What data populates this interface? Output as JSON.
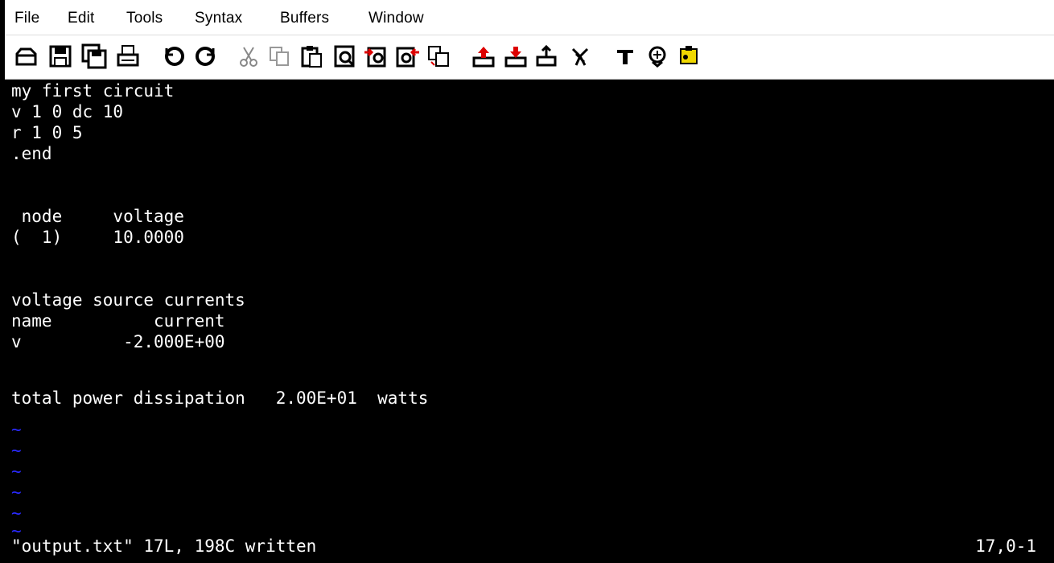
{
  "menu": {
    "items": [
      {
        "label": "File"
      },
      {
        "label": "Edit"
      },
      {
        "label": "Tools"
      },
      {
        "label": "Syntax"
      },
      {
        "label": "Buffers"
      },
      {
        "label": "Window"
      }
    ]
  },
  "toolbar": {
    "icons": [
      "open-icon",
      "save-icon",
      "save-all-icon",
      "print-icon",
      "undo-icon",
      "redo-icon",
      "cut-icon",
      "copy-icon",
      "paste-icon",
      "find-icon",
      "find-next-icon",
      "find-prev-icon",
      "replace-icon",
      "load-session-icon",
      "save-session-icon",
      "run-script-icon",
      "make-icon",
      "shell-icon",
      "ctags-icon"
    ]
  },
  "editor": {
    "lines": [
      "my first circuit",
      "v 1 0 dc 10",
      "r 1 0 5",
      ".end",
      "",
      "",
      " node     voltage",
      "(  1)     10.0000",
      "",
      "",
      "voltage source currents",
      "name          current",
      "v          -2.000E+00",
      "",
      "",
      "total power dissipation   2.00E+01  watts"
    ],
    "tilde_char": "~",
    "tilde_color": "#2a2aff"
  },
  "status": {
    "message": "\"output.txt\" 17L, 198C written",
    "position": "17,0-1"
  }
}
